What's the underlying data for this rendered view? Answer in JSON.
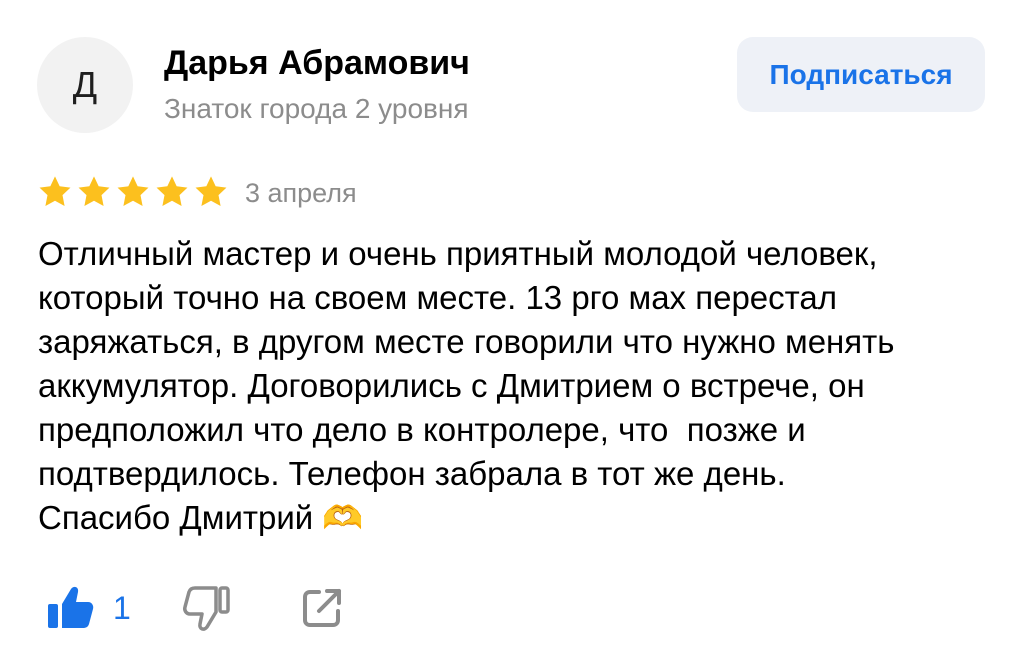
{
  "author": {
    "initial": "Д",
    "name": "Дарья Абрамович",
    "level": "Знаток города 2 уровня"
  },
  "subscribe_label": "Подписаться",
  "review": {
    "rating": 5,
    "date": "3 апреля",
    "text_lines": [
      "Отличный мастер и очень приятный молодой человек,",
      "который точно на своем месте. 13 рго мах перестал",
      "заряжаться, в другом месте говорили что нужно менять",
      "аккумулятор. Договорились с Дмитрием о встрече, он",
      "предположил что дело в контролере, что  позже и",
      "подтвердилось. Телефон забрала в тот же день.",
      "Спасибо Дмитрий 🫶"
    ]
  },
  "actions": {
    "like_count": "1",
    "like_icon": "thumbs-up-icon",
    "dislike_icon": "thumbs-down-icon",
    "share_icon": "share-icon"
  },
  "colors": {
    "accent": "#1a73e8",
    "star": "#fcc01e",
    "muted": "#8c8c8c"
  }
}
